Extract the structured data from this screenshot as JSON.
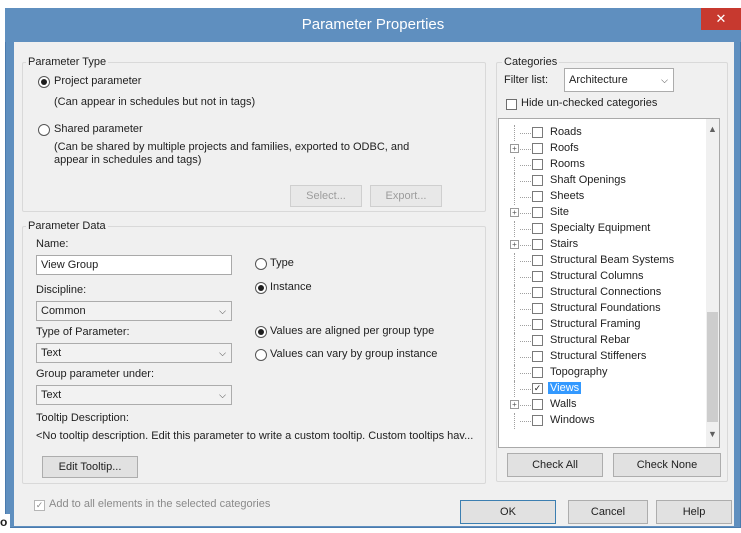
{
  "window": {
    "title": "Parameter Properties",
    "close": "✕"
  },
  "parameter_type": {
    "group_label": "Parameter Type",
    "project": {
      "label": "Project parameter",
      "note": "(Can appear in schedules but not in tags)",
      "checked": true
    },
    "shared": {
      "label": "Shared parameter",
      "note_line1": "(Can be shared by multiple projects and families, exported to ODBC, and",
      "note_line2": "appear in schedules and tags)",
      "checked": false
    },
    "select_label": "Select...",
    "export_label": "Export..."
  },
  "parameter_data": {
    "group_label": "Parameter Data",
    "name_label": "Name:",
    "name_value": "View Group",
    "type_label": "Type",
    "instance_label": "Instance",
    "discipline_label": "Discipline:",
    "discipline_value": "Common",
    "type_of_param_label": "Type of Parameter:",
    "type_of_param_value": "Text",
    "aligned_label": "Values are aligned per group type",
    "vary_label": "Values can vary by group instance",
    "group_under_label": "Group parameter under:",
    "group_under_value": "Text",
    "tooltip_label": "Tooltip Description:",
    "tooltip_text": "<No tooltip description. Edit this parameter to write a custom tooltip. Custom tooltips hav...",
    "edit_tooltip_label": "Edit Tooltip..."
  },
  "categories": {
    "group_label": "Categories",
    "filter_label": "Filter list:",
    "filter_value": "Architecture",
    "hide_label": "Hide un-checked categories",
    "items": [
      {
        "label": "Roads",
        "expandable": false,
        "checked": false
      },
      {
        "label": "Roofs",
        "expandable": true,
        "checked": false
      },
      {
        "label": "Rooms",
        "expandable": false,
        "checked": false
      },
      {
        "label": "Shaft Openings",
        "expandable": false,
        "checked": false
      },
      {
        "label": "Sheets",
        "expandable": false,
        "checked": false
      },
      {
        "label": "Site",
        "expandable": true,
        "checked": false
      },
      {
        "label": "Specialty Equipment",
        "expandable": false,
        "checked": false
      },
      {
        "label": "Stairs",
        "expandable": true,
        "checked": false
      },
      {
        "label": "Structural Beam Systems",
        "expandable": false,
        "checked": false
      },
      {
        "label": "Structural Columns",
        "expandable": false,
        "checked": false
      },
      {
        "label": "Structural Connections",
        "expandable": false,
        "checked": false
      },
      {
        "label": "Structural Foundations",
        "expandable": false,
        "checked": false
      },
      {
        "label": "Structural Framing",
        "expandable": false,
        "checked": false
      },
      {
        "label": "Structural Rebar",
        "expandable": false,
        "checked": false
      },
      {
        "label": "Structural Stiffeners",
        "expandable": false,
        "checked": false
      },
      {
        "label": "Topography",
        "expandable": false,
        "checked": false
      },
      {
        "label": "Views",
        "expandable": false,
        "checked": true,
        "selected": true
      },
      {
        "label": "Walls",
        "expandable": true,
        "checked": false
      },
      {
        "label": "Windows",
        "expandable": false,
        "checked": false
      }
    ],
    "check_all_label": "Check All",
    "check_none_label": "Check None"
  },
  "footer": {
    "add_all_label": "Add to all elements in the selected categories",
    "ok_label": "OK",
    "cancel_label": "Cancel",
    "help_label": "Help",
    "corner_char": "o"
  }
}
